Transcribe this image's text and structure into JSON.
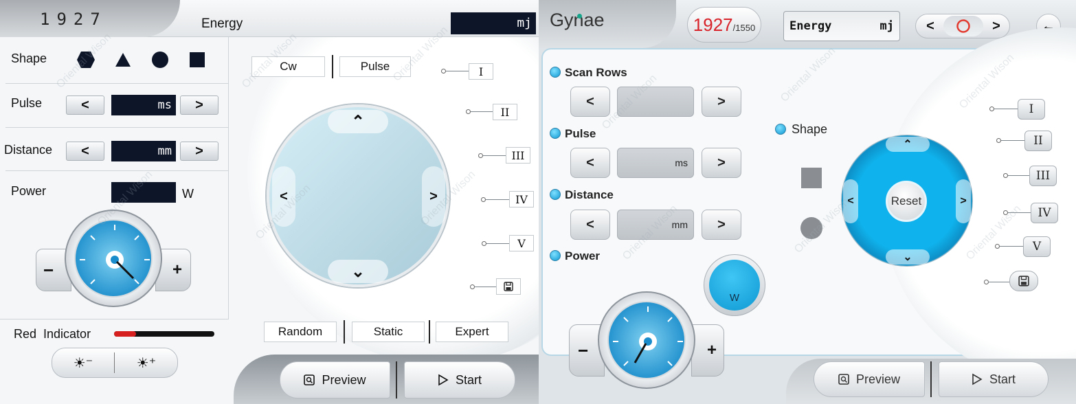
{
  "left": {
    "code": "1927",
    "energy_label": "Energy",
    "energy_unit": "mj",
    "shape": {
      "label": "Shape"
    },
    "pulse": {
      "label": "Pulse",
      "unit": "ms",
      "prev": "<",
      "next": ">"
    },
    "distance": {
      "label": "Distance",
      "unit": "mm",
      "prev": "<",
      "next": ">"
    },
    "power": {
      "label": "Power",
      "unit": "W",
      "minus": "−",
      "plus": "+"
    },
    "red_indicator": {
      "label": "Red  Indicator",
      "level": 0.22
    },
    "brightness": {
      "down": "☀⁻",
      "up": "☀⁺"
    },
    "mode_tabs": [
      "Cw",
      "Pulse"
    ],
    "joystick": {
      "up": "⌃",
      "down": "⌄",
      "left": "<",
      "right": ">"
    },
    "presets": [
      "I",
      "II",
      "III",
      "IV",
      "V"
    ],
    "bottom_modes": [
      "Random",
      "Static",
      "Expert"
    ],
    "preview_label": "Preview",
    "start_label": "Start"
  },
  "right": {
    "title": "Gynae",
    "counter_main": "1927",
    "counter_sub": "/1550",
    "energy_label": "Energy",
    "energy_unit": "mj",
    "nav": {
      "prev": "<",
      "next": ">"
    },
    "back": "←",
    "scan_rows": {
      "label": "Scan Rows",
      "prev": "<",
      "next": ">"
    },
    "pulse": {
      "label": "Pulse",
      "unit": "ms",
      "prev": "<",
      "next": ">"
    },
    "distance": {
      "label": "Distance",
      "unit": "mm",
      "prev": "<",
      "next": ">"
    },
    "power": {
      "label": "Power",
      "unit": "W",
      "minus": "−",
      "plus": "+"
    },
    "shape": {
      "label": "Shape"
    },
    "reset_label": "Reset",
    "joystick": {
      "up": "⌃",
      "down": "⌄",
      "left": "<",
      "right": ">"
    },
    "presets": [
      "I",
      "II",
      "III",
      "IV",
      "V"
    ],
    "preview_label": "Preview",
    "start_label": "Start"
  },
  "watermark": "Oriental Wison",
  "colors": {
    "accent_blue": "#0e98d2",
    "dark_field": "#0d1529",
    "red_indicator": "#d61f1f"
  }
}
